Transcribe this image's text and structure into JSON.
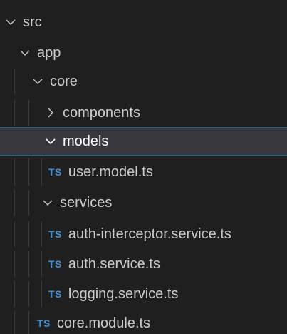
{
  "explorer": {
    "items": [
      {
        "label": "src",
        "type": "folder",
        "expanded": true,
        "icon": "chevron-down-icon"
      },
      {
        "label": "app",
        "type": "folder",
        "expanded": true,
        "icon": "chevron-down-icon"
      },
      {
        "label": "core",
        "type": "folder",
        "expanded": true,
        "icon": "chevron-down-icon"
      },
      {
        "label": "components",
        "type": "folder",
        "expanded": false,
        "icon": "chevron-right-icon"
      },
      {
        "label": "models",
        "type": "folder",
        "expanded": true,
        "selected": true,
        "icon": "chevron-down-icon"
      },
      {
        "label": "user.model.ts",
        "type": "file",
        "badge": "TS",
        "icon": "typescript-file-icon"
      },
      {
        "label": "services",
        "type": "folder",
        "expanded": true,
        "icon": "chevron-down-icon"
      },
      {
        "label": "auth-interceptor.service.ts",
        "type": "file",
        "badge": "TS",
        "icon": "typescript-file-icon"
      },
      {
        "label": "auth.service.ts",
        "type": "file",
        "badge": "TS",
        "icon": "typescript-file-icon"
      },
      {
        "label": "logging.service.ts",
        "type": "file",
        "badge": "TS",
        "icon": "typescript-file-icon"
      },
      {
        "label": "core.module.ts",
        "type": "file",
        "badge": "TS",
        "icon": "typescript-file-icon"
      }
    ]
  },
  "colors": {
    "background": "#1f1f1f",
    "selected_background": "#37373d",
    "selected_border": "#0e639c",
    "text": "#cccccc",
    "ts_badge": "#3d8fd6",
    "indent_guide": "#3b3b3b"
  }
}
